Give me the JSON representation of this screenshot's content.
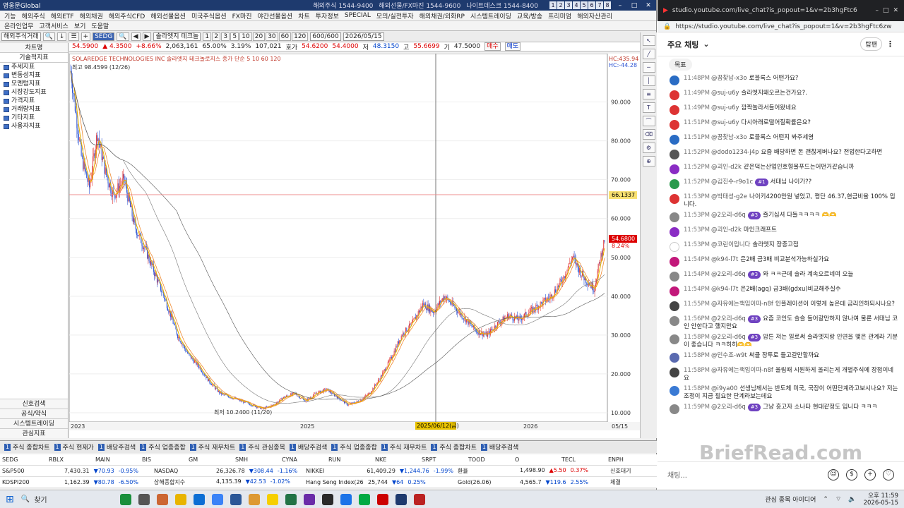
{
  "app": {
    "title": "영웅문Global",
    "services": [
      "해외주식 1544-9400",
      "해외선물/FX마진 1544-9600",
      "나이트데스크 1544-8400"
    ],
    "num_tabs": [
      "1",
      "2",
      "3",
      "4",
      "5",
      "6",
      "7",
      "8"
    ]
  },
  "menu": [
    "기능",
    "해외주식",
    "해외ETF",
    "해외채권",
    "해외주식CFD",
    "해외선물옵션",
    "미국주식옵션",
    "FX마진",
    "야간선물옵션",
    "차트",
    "투자정보",
    "SPECIAL",
    "모의/실전투자",
    "해외채권/외화RP",
    "시스템트레이딩",
    "교육/방송",
    "프리미엄",
    "해외자산관리"
  ],
  "menu2": [
    "온라인업무",
    "고객서비스",
    "보기",
    "도움말"
  ],
  "toolbar": {
    "symbol_label": "해외주식거래",
    "code": "SEDG",
    "name": "솔라엣지 테크놀",
    "periods": [
      "1",
      "2",
      "3",
      "5",
      "10",
      "20",
      "30",
      "60",
      "120"
    ],
    "count": "600/600",
    "date": "2026/05/15"
  },
  "quote": {
    "price": "54.5900",
    "change": "▲ 4.3500",
    "pct": "+8.66%",
    "volume": "2,063,161",
    "vol_pct": "65.00%",
    "rate": "3.19%",
    "amount": "107,021",
    "ask_label": "호가",
    "ask": "54.6200",
    "bid": "54.4000",
    "low_label": "저",
    "low": "48.3150",
    "high_label": "고",
    "high": "55.6699",
    "close_label": "기",
    "close": "47.5000",
    "btn_buy": "매수",
    "btn_sell": "매도"
  },
  "leftpanel": {
    "header": "차트명",
    "sub": "기술적지표",
    "items": [
      "추세지표",
      "변동성지표",
      "모멘텀지표",
      "시장강도지표",
      "가격지표",
      "거래량지표",
      "기타지표",
      "사용자지표"
    ],
    "bottom": [
      "신호검색",
      "공식/약식",
      "시스템트레이딩",
      "관심지표"
    ]
  },
  "chart_data": {
    "type": "candlestick",
    "title": "SOLAREDGE TECHNOLOGIES INC 솔라엣지 테크놀로지스 종가 단순 5 10 60 120",
    "high_note": "최고 98.4599 (12/26)",
    "low_note": "최저 10.2400 (11/20)",
    "yticks": [
      10,
      20,
      30,
      40,
      50,
      60,
      70,
      80,
      90
    ],
    "ytick_labels": [
      "10.000",
      "20.000",
      "30.000",
      "40.000",
      "50.000",
      "60.000",
      "70.000",
      "80.000",
      "90.000"
    ],
    "ylim": [
      8,
      101
    ],
    "xticks": [
      "2023",
      "2025",
      "2026"
    ],
    "x_last": "05/15",
    "crosshair_date": "2025/06/12(금)",
    "crosshair_value": "66.1337",
    "last_price": "54.6800",
    "last_pct": "8.24%",
    "hc_label": "HC:435.94",
    "lc_label": "HC:-44.28",
    "close_path": [
      [
        0,
        98
      ],
      [
        0.02,
        76
      ],
      [
        0.035,
        68
      ],
      [
        0.05,
        82
      ],
      [
        0.065,
        72
      ],
      [
        0.08,
        66
      ],
      [
        0.1,
        70
      ],
      [
        0.12,
        58
      ],
      [
        0.14,
        52
      ],
      [
        0.16,
        45
      ],
      [
        0.18,
        38
      ],
      [
        0.2,
        30
      ],
      [
        0.22,
        25
      ],
      [
        0.24,
        22
      ],
      [
        0.26,
        18
      ],
      [
        0.28,
        15
      ],
      [
        0.3,
        14
      ],
      [
        0.32,
        13
      ],
      [
        0.34,
        12
      ],
      [
        0.36,
        11
      ],
      [
        0.38,
        12
      ],
      [
        0.4,
        14
      ],
      [
        0.42,
        15
      ],
      [
        0.44,
        13
      ],
      [
        0.46,
        15
      ],
      [
        0.48,
        16
      ],
      [
        0.5,
        14
      ],
      [
        0.52,
        12
      ],
      [
        0.54,
        13
      ],
      [
        0.56,
        15
      ],
      [
        0.58,
        19
      ],
      [
        0.6,
        24
      ],
      [
        0.62,
        30
      ],
      [
        0.64,
        33
      ],
      [
        0.66,
        38
      ],
      [
        0.68,
        36
      ],
      [
        0.7,
        40
      ],
      [
        0.72,
        37
      ],
      [
        0.74,
        34
      ],
      [
        0.76,
        31
      ],
      [
        0.78,
        30
      ],
      [
        0.8,
        33
      ],
      [
        0.82,
        35
      ],
      [
        0.84,
        34
      ],
      [
        0.86,
        36
      ],
      [
        0.88,
        38
      ],
      [
        0.9,
        40
      ],
      [
        0.92,
        44
      ],
      [
        0.94,
        50
      ],
      [
        0.96,
        45
      ],
      [
        0.98,
        42
      ],
      [
        1,
        54.6
      ]
    ]
  },
  "tabs": [
    "주식 종합차트",
    "주식 현재가",
    "배당주검색",
    "주식 업종종합",
    "주식 재무차트",
    "주식 관심종목",
    "배당주검색",
    "주식 업종종합",
    "주식 재무차트",
    "주식 종합차트",
    "배당주검색"
  ],
  "ticker": [
    [
      {
        "name": "SEDG",
        "v": ""
      },
      {
        "name": "RBLX",
        "v": ""
      },
      {
        "name": "MAIN",
        "v": ""
      },
      {
        "name": "BIS",
        "v": ""
      },
      {
        "name": "GM",
        "v": ""
      },
      {
        "name": "SMH",
        "v": ""
      },
      {
        "name": "CYNA",
        "v": ""
      },
      {
        "name": "RUN",
        "v": ""
      },
      {
        "name": "NKE",
        "v": ""
      },
      {
        "name": "SRPT",
        "v": ""
      },
      {
        "name": "TOOD",
        "v": ""
      },
      {
        "name": "O",
        "v": ""
      },
      {
        "name": "TECL",
        "v": ""
      },
      {
        "name": "ENPH",
        "v": ""
      }
    ],
    [
      {
        "name": "S&P500",
        "a": "7,430.31",
        "b": "▼70.93",
        "c": "-0.95%"
      },
      {
        "name": "NASDAQ",
        "a": "26,326.78",
        "b": "▼308.44",
        "c": "-1.16%"
      },
      {
        "name": "NIKKEI",
        "a": "61,409.29",
        "b": "▼1,244.76",
        "c": "-1.99%"
      },
      {
        "name": "환율",
        "a": "1,498.90",
        "b": "▲5.50",
        "c": "0.37%"
      }
    ],
    [
      {
        "name": "KOSPI200",
        "a": "1,162.39",
        "b": "▼80.78",
        "c": "-6.50%"
      },
      {
        "name": "상해종합지수",
        "a": "4,135.39",
        "b": "▼42.53",
        "c": "-1.02%"
      },
      {
        "name": "Hang Seng Index(26.05)",
        "a": "25,744",
        "b": "▼64",
        "c": "0.25%"
      },
      {
        "name": "Gold(26.06)",
        "a": "4,565.7",
        "b": "▼119.6",
        "c": "2.55%"
      }
    ]
  ],
  "ticker_right": [
    "신호대기",
    "체결",
    "감시"
  ],
  "browser": {
    "title": "studio.youtube.com/live_chat?is_popout=1&v=2b3hgFtc6",
    "url": "https://studio.youtube.com/live_chat?is_popout=1&v=2b3hgFtc6zw",
    "chat_title": "주요 채팅",
    "pill": "탑팬",
    "pinned": "목표",
    "input": "채팅..."
  },
  "chat": [
    {
      "t": "11:48PM",
      "u": "@꿈찾남-x3o",
      "m": "로블록스 어떤가요?",
      "c": "#2a6cc4"
    },
    {
      "t": "11:49PM",
      "u": "@suj-u6y",
      "m": "솔라엣지왜오르는건가요?.",
      "c": "#d33"
    },
    {
      "t": "11:49PM",
      "u": "@suj-u6y",
      "m": "깜짝놀라서들어왔네요",
      "c": "#d33"
    },
    {
      "t": "11:51PM",
      "u": "@suj-u6y",
      "m": "다시아래로떨어질확률은요?",
      "c": "#d33"
    },
    {
      "t": "11:51PM",
      "u": "@꿈찾남-x3o",
      "m": "로블록스 어떤지 봐주세영",
      "c": "#2a6cc4"
    },
    {
      "t": "11:52PM",
      "u": "@dodo1234-j4p",
      "m": "요즘 배당하면 돈 괜찮게버나요? 전업한다고하면",
      "c": "#555"
    },
    {
      "t": "11:52PM",
      "u": "@괴인-d2k",
      "m": "같은덕는산업인호형물푸드는어떤거같습니까",
      "c": "#8a2cc4"
    },
    {
      "t": "11:52PM",
      "u": "@김진수-r9o1c",
      "m": "서태님 나이가??",
      "c": "#2a9a4c",
      "b": "#1"
    },
    {
      "t": "11:53PM",
      "u": "@박태성-g2e",
      "m": "나이키4200만원 넣었고, 평단 46.37,현금비율 100% 입니다.",
      "c": "#d33"
    },
    {
      "t": "11:53PM",
      "u": "@2오리-d6q",
      "m": "즐기십셔 다들ㅋㅋㅋㅋ 🫶🫶",
      "c": "#888",
      "b": "#3"
    },
    {
      "t": "11:53PM",
      "u": "@괴인-d2k",
      "m": "마인크래프트",
      "c": "#8a2cc4"
    },
    {
      "t": "11:53PM",
      "u": "@코린이입니다",
      "m": "솔라엣지 장중고점",
      "c": "#fff"
    },
    {
      "t": "11:54PM",
      "u": "@k94-l7t",
      "m": "은2배 금3배 비교분석가능하실가요",
      "c": "#c2187a"
    },
    {
      "t": "11:54PM",
      "u": "@2오리-d6q",
      "m": "와 ㅋㅋ근데 솔라 계속오르네여 오늘",
      "c": "#888",
      "b": "#3"
    },
    {
      "t": "11:54PM",
      "u": "@k94-l7t",
      "m": "은2배(agq) 금3배(gdxu)비교해주실수",
      "c": "#c2187a"
    },
    {
      "t": "11:55PM",
      "u": "@자유에는책임이따-n8f",
      "m": "인플레이션이 이렇게 높은데 금리인하되시나요?",
      "c": "#444"
    },
    {
      "t": "11:56PM",
      "u": "@2오리-d6q",
      "m": "요즘 코인도 슬슬 들어갈만하지 않나여 물론 서태님 코인 안한다고 했지만요",
      "c": "#888",
      "b": "#3"
    },
    {
      "t": "11:58PM",
      "u": "@2오리-d6q",
      "m": "암튼 저는 일로써 솔라엣지랑 인연을 맺은 관계라 기분이 좋습니다 ㅋㅋ히히🫶🫶",
      "c": "#888",
      "b": "#3"
    },
    {
      "t": "11:58PM",
      "u": "@민수조-w9t",
      "m": "써클 장투로 들고갈만할까요",
      "c": "#5a6ab0"
    },
    {
      "t": "11:58PM",
      "u": "@자유에는책임이따-n8f",
      "m": "울림때 시원하게 올리는게 개별주식에 장점이네요",
      "c": "#444"
    },
    {
      "t": "11:58PM",
      "u": "@i9ya00",
      "m": "선생님께서는 반도체 미국, 국장이 어떤단계라고보시나요? 저는 조정이 지금 필요한 단계라보는데요",
      "c": "#3a7ad4"
    },
    {
      "t": "11:59PM",
      "u": "@2오리-d6q",
      "m": "그냥 흥고자 소나타 현대같정도 입니다 ㅋㅋㅋ",
      "c": "#888",
      "b": "#3"
    }
  ],
  "watermark": "BriefRead.com",
  "taskbar": {
    "search": "찾기",
    "tray": "관심 종목 아이디어",
    "time": "오후 11:59",
    "date": "2026-05-15"
  }
}
